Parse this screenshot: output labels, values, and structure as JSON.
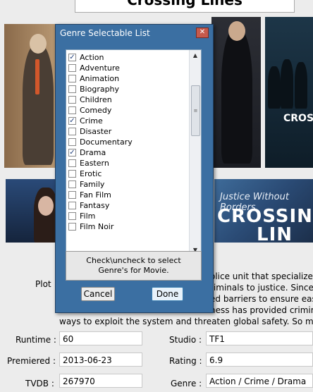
{
  "show_title": "Crossing Lines",
  "banner": {
    "tagline": "Justice Without Borders",
    "title_line1": "CROSSING",
    "title_line2": "LIN",
    "poster_title": "CROSS"
  },
  "plot": {
    "label": "Plot",
    "lines": [
      "olice unit that specializes",
      "riminals to justice. Since",
      "ed barriers to ensure easy",
      "ness has provided crimina",
      "ways to exploit the system and threaten global safety. So much so t"
    ]
  },
  "details": {
    "runtime_label": "Runtime :",
    "runtime_value": "60",
    "premiered_label": "Premiered :",
    "premiered_value": "2013-06-23",
    "tvdb_label": "TVDB :",
    "tvdb_value": "267970",
    "studio_label": "Studio :",
    "studio_value": "TF1",
    "rating_label": "Rating :",
    "rating_value": "6.9",
    "genre_label": "Genre :",
    "genre_value": "Action / Crime / Drama"
  },
  "dialog": {
    "title": "Genre Selectable List",
    "close_icon": "close-icon",
    "genres": [
      {
        "label": "Action",
        "checked": true
      },
      {
        "label": "Adventure",
        "checked": false
      },
      {
        "label": "Animation",
        "checked": false
      },
      {
        "label": "Biography",
        "checked": false
      },
      {
        "label": "Children",
        "checked": false
      },
      {
        "label": "Comedy",
        "checked": false
      },
      {
        "label": "Crime",
        "checked": true
      },
      {
        "label": "Disaster",
        "checked": false
      },
      {
        "label": "Documentary",
        "checked": false
      },
      {
        "label": "Drama",
        "checked": true
      },
      {
        "label": "Eastern",
        "checked": false
      },
      {
        "label": "Erotic",
        "checked": false
      },
      {
        "label": "Family",
        "checked": false
      },
      {
        "label": "Fan Film",
        "checked": false
      },
      {
        "label": "Fantasy",
        "checked": false
      },
      {
        "label": "Film",
        "checked": false
      },
      {
        "label": "Film Noir",
        "checked": false
      }
    ],
    "hint_line1": "Check\\uncheck to select",
    "hint_line2": "Genre's for Movie.",
    "cancel_label": "Cancel",
    "done_label": "Done"
  },
  "colors": {
    "dialog_background": "#3b6fa2",
    "close_button": "#c65a4c"
  }
}
